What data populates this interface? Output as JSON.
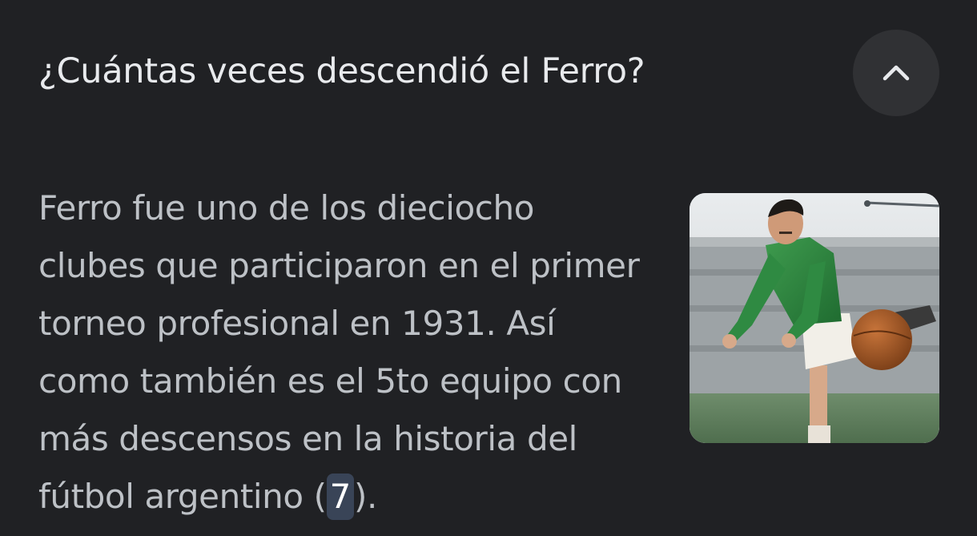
{
  "faq": {
    "question": "¿Cuántas veces descendió el Ferro?",
    "collapse_icon": "chevron-up-icon",
    "answer_lines": [
      "Ferro fue uno de los dieciocho",
      "clubes que participaron en el primer",
      "torneo profesional en 1931. Así",
      "como también es el 5to equipo con",
      "más descensos en la historia del"
    ],
    "answer_last_prefix": "fútbol argentino (",
    "answer_highlight": "7",
    "answer_last_suffix": ").",
    "image": "footballer-photo"
  },
  "colors": {
    "background": "#202124",
    "question_text": "#e8eaed",
    "answer_text": "#bdc1c6",
    "button_bg": "#303134",
    "highlight_bg": "#394457"
  }
}
